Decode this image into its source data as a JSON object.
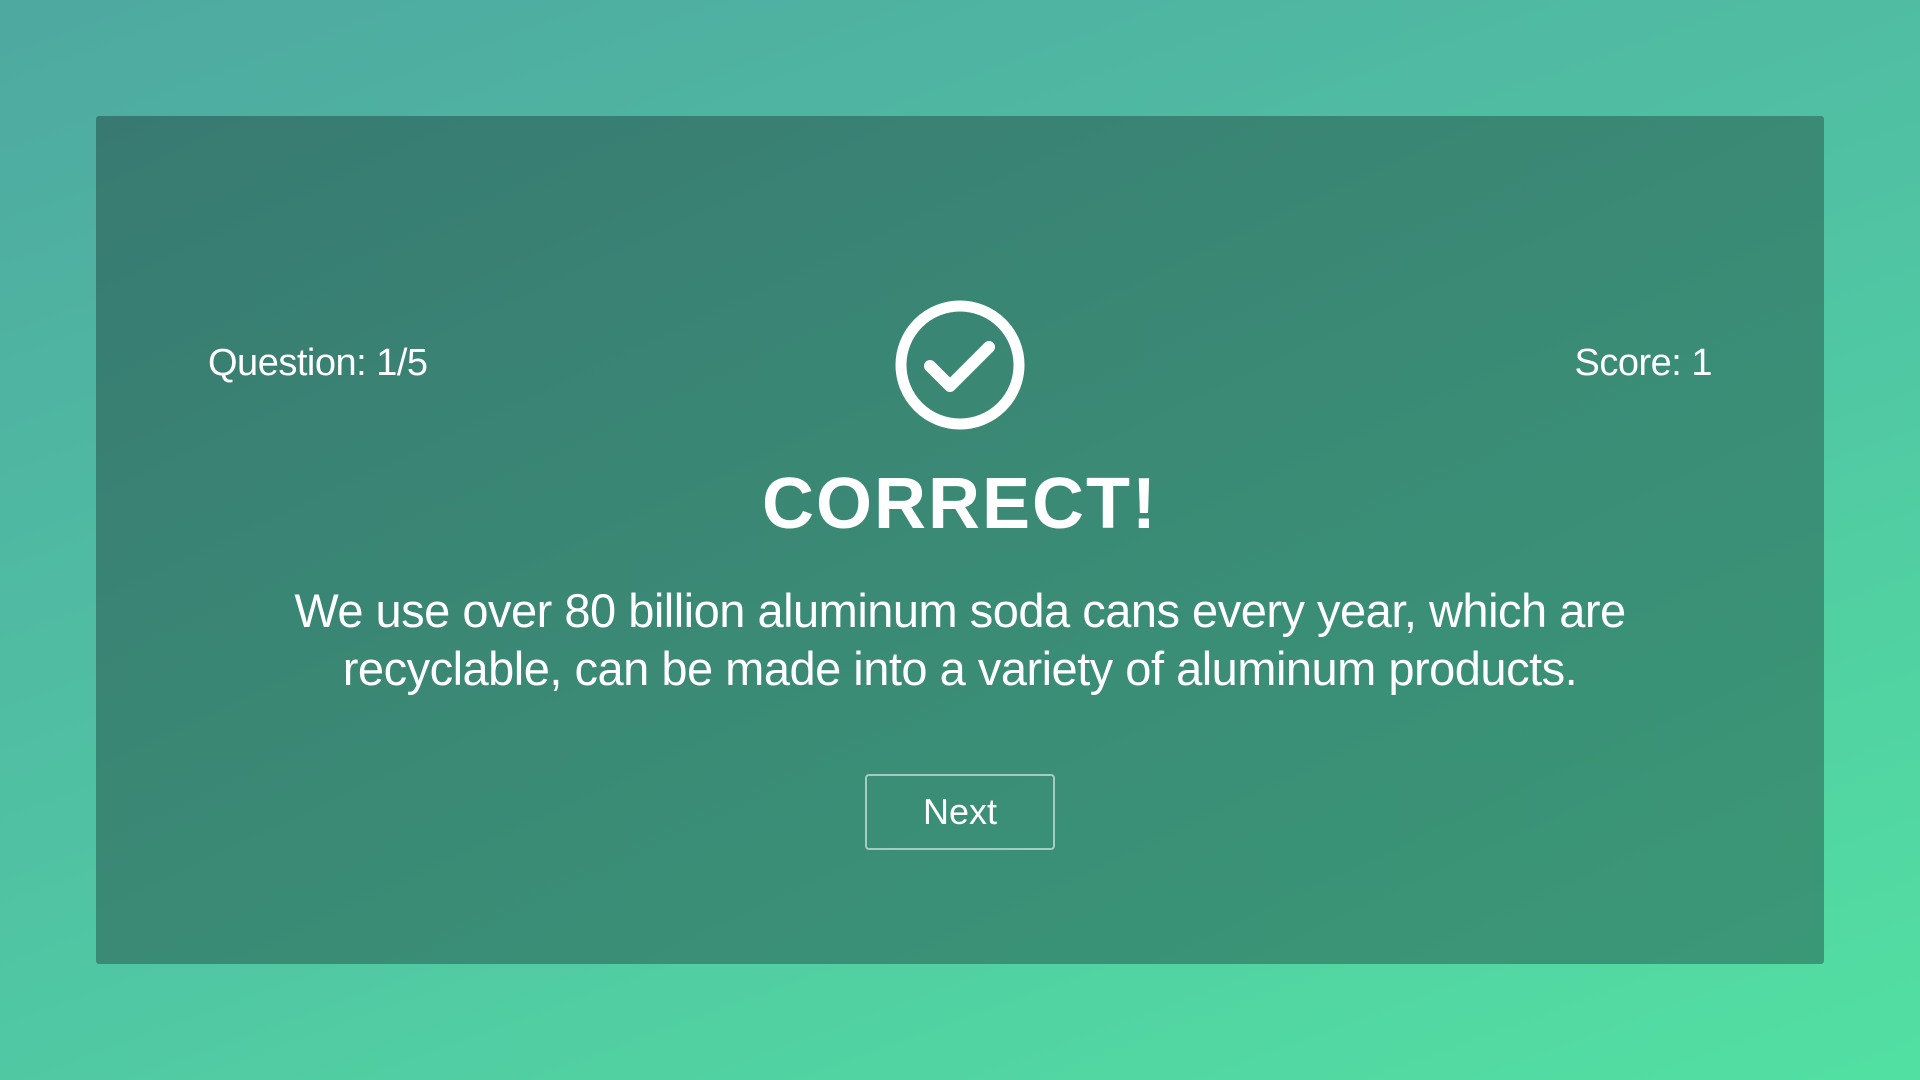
{
  "quiz": {
    "question_label": "Question: 1/5",
    "score_label": "Score: 1"
  },
  "result": {
    "icon": "check-circle-icon",
    "title": "CORRECT!",
    "explanation": "We use over 80 billion aluminum soda cans every year, which are recyclable, can be made into a variety of aluminum products."
  },
  "actions": {
    "next_label": "Next"
  },
  "colors": {
    "background_start": "#4ea9a0",
    "background_end": "#52e0a2",
    "card_start": "#387a72",
    "card_end": "#3b9877",
    "text": "#ffffff"
  }
}
